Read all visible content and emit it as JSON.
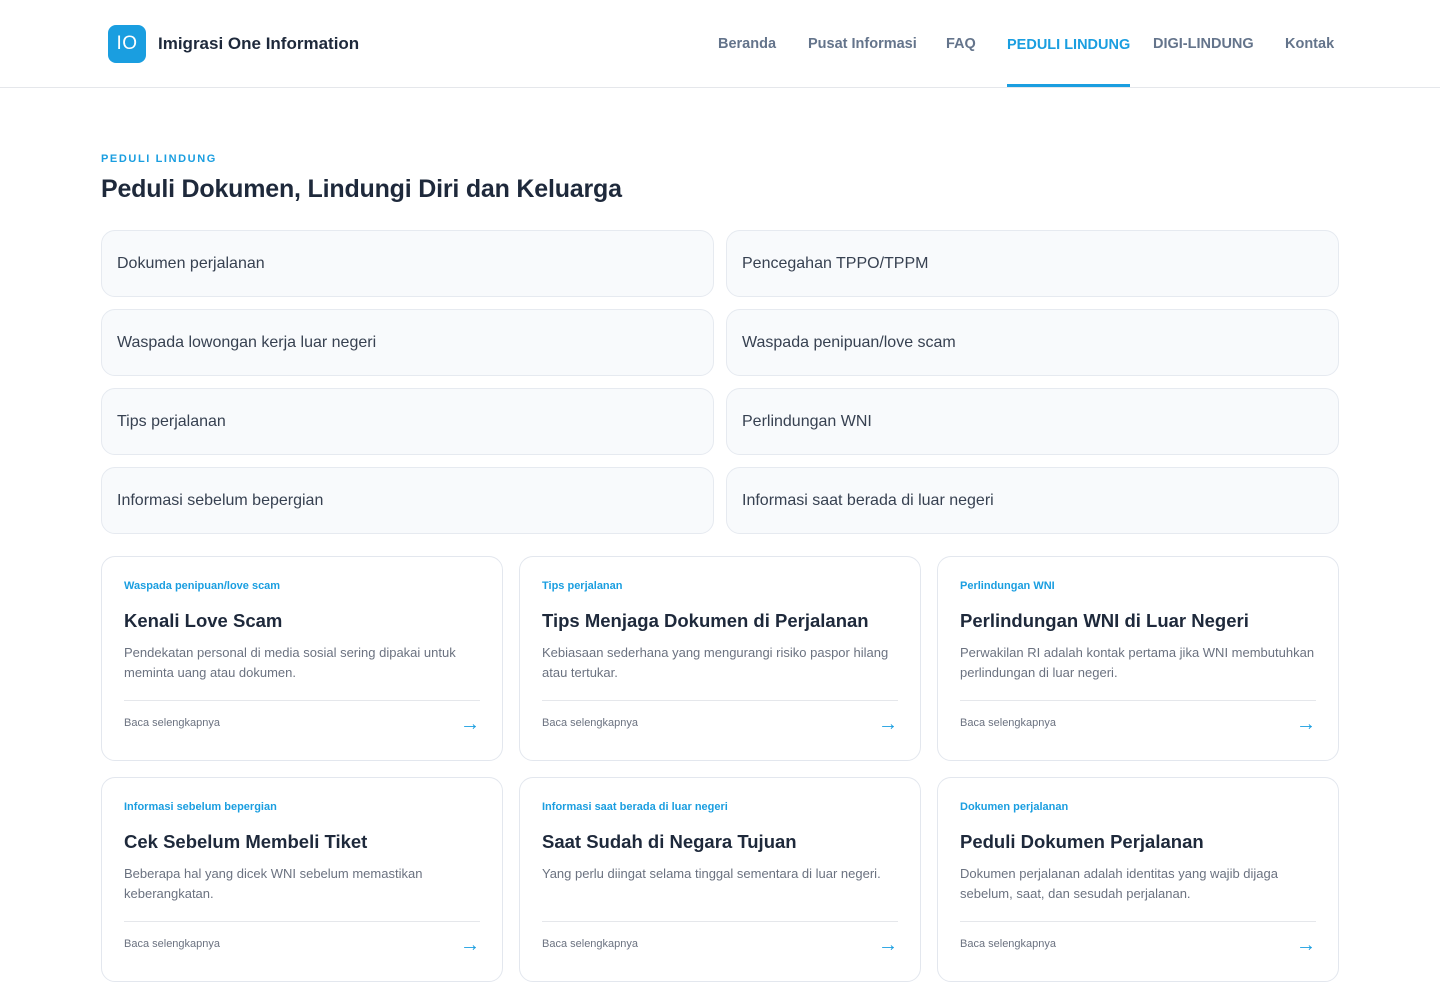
{
  "header": {
    "logo_text": "IO",
    "brand_name": "Imigrasi One Information",
    "nav": [
      "Beranda",
      "Pusat Informasi",
      "FAQ",
      "PEDULI LINDUNG",
      "DIGI-LINDUNG",
      "Kontak"
    ],
    "active_nav": "PEDULI LINDUNG"
  },
  "hero": {
    "eyebrow": "PEDULI LINDUNG",
    "title": "Peduli Dokumen, Lindungi Diri dan Keluarga"
  },
  "topics": [
    "Dokumen perjalanan",
    "Pencegahan TPPO/TPPM",
    "Waspada lowongan kerja luar negeri",
    "Waspada penipuan/love scam",
    "Tips perjalanan",
    "Perlindungan WNI",
    "Informasi sebelum bepergian",
    "Informasi saat berada di luar negeri"
  ],
  "cards": [
    {
      "category": "Waspada penipuan/love scam",
      "title": "Kenali Love Scam",
      "desc": "Pendekatan personal di media sosial sering dipakai untuk meminta uang atau dokumen.",
      "more": "Baca selengkapnya",
      "arrow": "→"
    },
    {
      "category": "Tips perjalanan",
      "title": "Tips Menjaga Dokumen di Perjalanan",
      "desc": "Kebiasaan sederhana yang mengurangi risiko paspor hilang atau tertukar.",
      "more": "Baca selengkapnya",
      "arrow": "→"
    },
    {
      "category": "Perlindungan WNI",
      "title": "Perlindungan WNI di Luar Negeri",
      "desc": "Perwakilan RI adalah kontak pertama jika WNI membutuhkan perlindungan di luar negeri.",
      "more": "Baca selengkapnya",
      "arrow": "→"
    },
    {
      "category": "Informasi sebelum bepergian",
      "title": "Cek Sebelum Membeli Tiket",
      "desc": "Beberapa hal yang dicek WNI sebelum memastikan keberangkatan.",
      "more": "Baca selengkapnya",
      "arrow": "→"
    },
    {
      "category": "Informasi saat berada di luar negeri",
      "title": "Saat Sudah di Negara Tujuan",
      "desc": "Yang perlu diingat selama tinggal sementara di luar negeri.",
      "more": "Baca selengkapnya",
      "arrow": "→"
    },
    {
      "category": "Dokumen perjalanan",
      "title": "Peduli Dokumen Perjalanan",
      "desc": "Dokumen perjalanan adalah identitas yang wajib dijaga sebelum, saat, dan sesudah perjalanan.",
      "more": "Baca selengkapnya",
      "arrow": "→"
    }
  ],
  "colors": {
    "accent": "#1a9ee0",
    "heading": "#1e293b",
    "muted": "#6b7280",
    "topic_bg": "#f8fafc"
  }
}
